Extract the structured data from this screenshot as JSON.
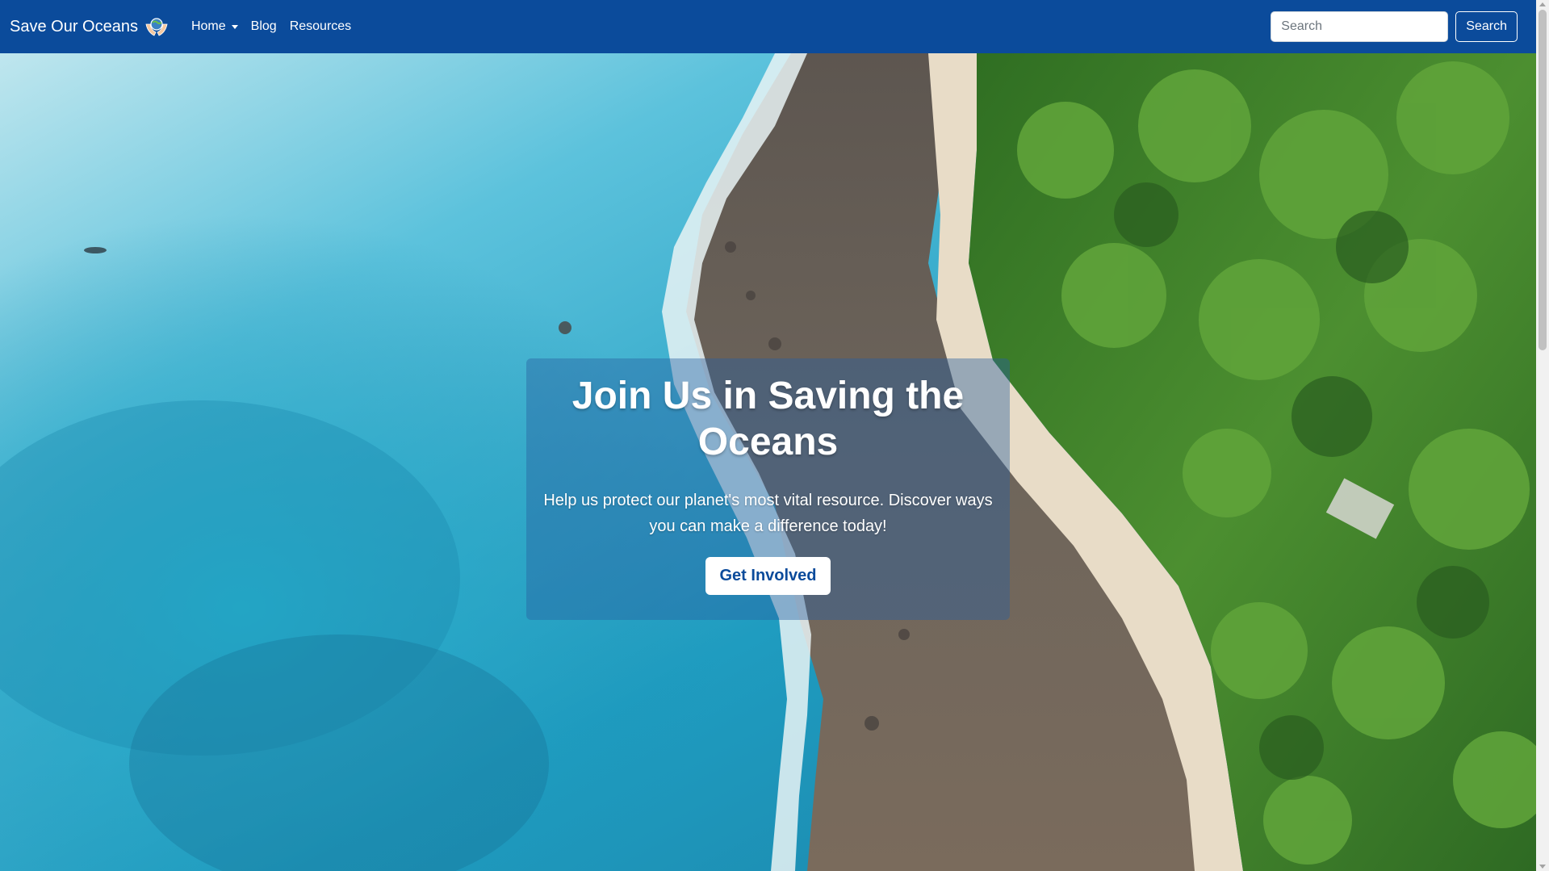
{
  "navbar": {
    "brand": "Save Our Oceans",
    "brand_icon": "hands-holding-globe-icon",
    "links": [
      {
        "label": "Home",
        "has_dropdown": true
      },
      {
        "label": "Blog"
      },
      {
        "label": "Resources"
      }
    ],
    "search": {
      "placeholder": "Search",
      "button_label": "Search"
    }
  },
  "hero": {
    "title": "Join Us in Saving the Oceans",
    "subtitle": "Help us protect our planet's most vital resource. Discover ways you can make a difference today!",
    "cta_label": "Get Involved"
  },
  "colors": {
    "navbar": "#0b4b9b",
    "cta_text": "#0b4b9b",
    "ocean": "#2aa6c4",
    "forest": "#3f7d2a"
  }
}
